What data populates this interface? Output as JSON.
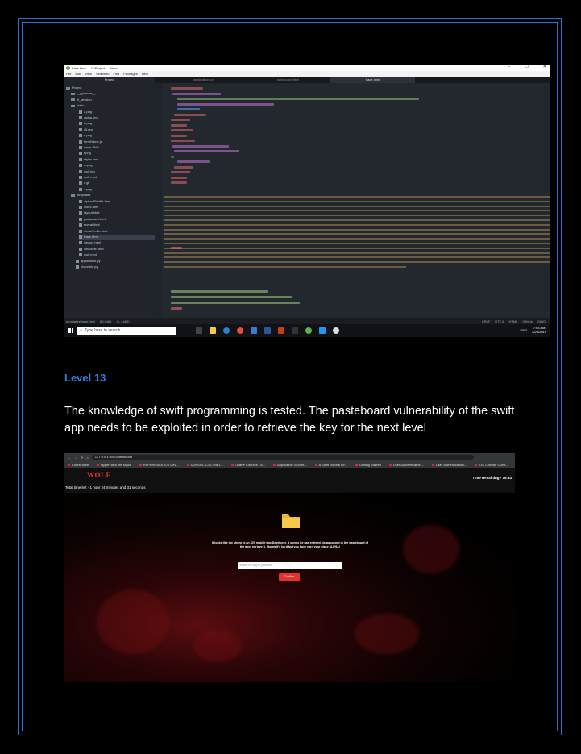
{
  "atom": {
    "window_title": "trace.html — C:\\Project — Atom",
    "window_buttons": [
      "–",
      "☐",
      "✕"
    ],
    "menu": [
      "File",
      "Edit",
      "View",
      "Selection",
      "Find",
      "Packages",
      "Help"
    ],
    "tabs": {
      "project": "Project",
      "files": [
        "application.py",
        "passboard.html",
        "trace.html"
      ],
      "active": "trace.html"
    },
    "tree": [
      {
        "label": "Project",
        "kind": "dir"
      },
      {
        "label": "__pycache__",
        "kind": "dir"
      },
      {
        "label": "fil_session",
        "kind": "dir"
      },
      {
        "label": "static",
        "kind": "dir"
      },
      {
        "label": "a.png",
        "kind": "file"
      },
      {
        "label": "alpha.png",
        "kind": "file"
      },
      {
        "label": "b.png",
        "kind": "file"
      },
      {
        "label": "c5.png",
        "kind": "file"
      },
      {
        "label": "d.png",
        "kind": "file"
      },
      {
        "label": "formName.js",
        "kind": "file"
      },
      {
        "label": "news.PNG",
        "kind": "file"
      },
      {
        "label": "r.png",
        "kind": "file"
      },
      {
        "label": "styles.css",
        "kind": "file"
      },
      {
        "label": "w.png",
        "kind": "file"
      },
      {
        "label": "wolf.jpg",
        "kind": "file"
      },
      {
        "label": "wolf.mp4",
        "kind": "file"
      },
      {
        "label": "x.gif",
        "kind": "file"
      },
      {
        "label": "z.png",
        "kind": "file"
      },
      {
        "label": "templates",
        "kind": "dir"
      },
      {
        "label": "alphaofProfile.html",
        "kind": "file"
      },
      {
        "label": "index.html",
        "kind": "file"
      },
      {
        "label": "layout.html",
        "kind": "file"
      },
      {
        "label": "passboard.html",
        "kind": "file"
      },
      {
        "label": "reveal.html",
        "kind": "file"
      },
      {
        "label": "showProfile.html",
        "kind": "file"
      },
      {
        "label": "trace.html",
        "kind": "file",
        "selected": true
      },
      {
        "label": "viewus.html",
        "kind": "file"
      },
      {
        "label": "welcome.html",
        "kind": "file"
      },
      {
        "label": "wolf.mp4",
        "kind": "file"
      },
      {
        "label": "application.py",
        "kind": "file"
      },
      {
        "label": "channels.py",
        "kind": "file"
      }
    ],
    "status": {
      "left": [
        "templates\\trace.html",
        "80:4461",
        "(1, 4460)"
      ],
      "right": [
        "CRLF",
        "UTF-8",
        "HTML",
        "GitHub",
        "Git (0)"
      ]
    },
    "taskbar": {
      "search_placeholder": "Type here to search",
      "lang": "ENG",
      "time": "7:03 AM",
      "date": "4/23/2019"
    }
  },
  "level_title": "Level 13",
  "description": "The knowledge of swift programming is tested. The pasteboard vulnerability of the swift app needs to be exploited in order to retrieve the key for the next level",
  "browser": {
    "url": "127.0.0.1:5000/passboard",
    "bookmarks": [
      "CourseWeb",
      "HyperHack the Stack",
      "HYPERHACK iOS Dev...",
      "D29 SDC C3 CYBEL...",
      "Online Courses - A...",
      "Application Securit...",
      "A Swift Tutorial for...",
      "Getting Started",
      "User Authentication...",
      "User Authentication...",
      "iOS Console Contr...",
      "iOS Push with Amaz..."
    ],
    "site_logo": "WOLF",
    "total_time": "Total time left - 1 hour 24 minutes and 31 seconds",
    "time_remaining": "Time remaining - 16:53",
    "message": "It looks like the sheep is an iOS mobile app Developer. It seems he has entered his password in the pasteboard of the app, retrieve it. I know it's hard but you have earn your place ALPHA!",
    "input_placeholder": "Enter the flag to proceed",
    "confirm_label": "Confirm"
  },
  "colors": {
    "accent_blue": "#2f7cd3",
    "frame_blue": "#2e6fd6",
    "wolf_red": "#e3322c"
  }
}
